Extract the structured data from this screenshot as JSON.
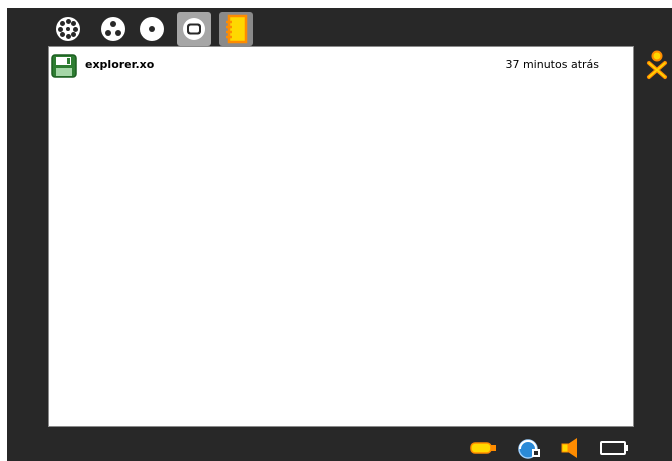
{
  "toolbar": {
    "buttons": [
      {
        "name": "neighborhood-zoom",
        "icon": "neighborhood-icon"
      },
      {
        "name": "group-zoom",
        "icon": "group-icon"
      },
      {
        "name": "home-zoom",
        "icon": "home-icon"
      },
      {
        "name": "activity-zoom",
        "icon": "activity-icon"
      },
      {
        "name": "journal",
        "icon": "journal-icon",
        "active": true
      }
    ]
  },
  "journal": {
    "entries": [
      {
        "title": "explorer.xo",
        "time": "37 minutos atrás",
        "icon": "floppy-disk-icon"
      }
    ]
  },
  "tray": {
    "items": [
      "usb-drive-icon",
      "network-icon",
      "speaker-icon",
      "battery-icon"
    ]
  },
  "colors": {
    "frame": "#282828",
    "panel": "#ffffff",
    "xo_stroke": "#ff8c00",
    "xo_fill": "#ffd800",
    "journal_icon_stroke": "#ff8c00",
    "journal_icon_fill": "#ffd800",
    "network_blue": "#2a8ad8"
  }
}
